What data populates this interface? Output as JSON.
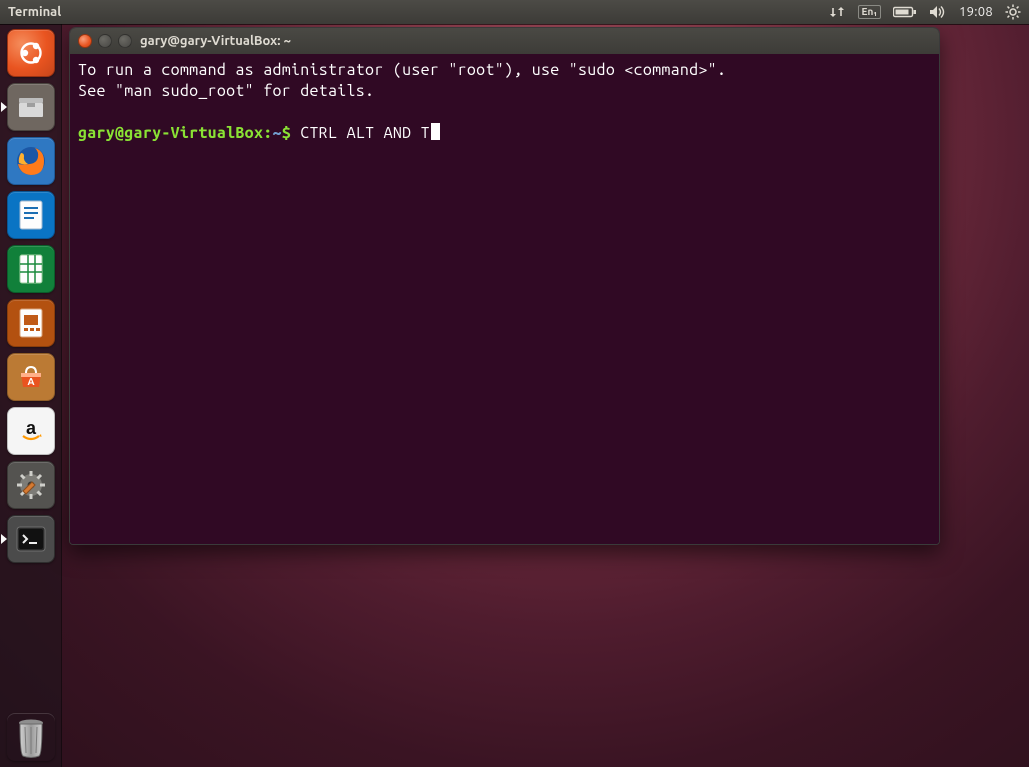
{
  "menubar": {
    "app_title": "Terminal",
    "lang": "En₁",
    "clock": "19:08"
  },
  "launcher": {
    "items": [
      {
        "name": "dash-home-icon"
      },
      {
        "name": "files-icon"
      },
      {
        "name": "firefox-icon"
      },
      {
        "name": "libreoffice-writer-icon"
      },
      {
        "name": "libreoffice-calc-icon"
      },
      {
        "name": "libreoffice-impress-icon"
      },
      {
        "name": "ubuntu-software-icon"
      },
      {
        "name": "amazon-icon"
      },
      {
        "name": "system-settings-icon"
      },
      {
        "name": "terminal-icon"
      },
      {
        "name": "trash-icon"
      }
    ]
  },
  "window": {
    "title": "gary@gary-VirtualBox: ~",
    "motd_line1": "To run a command as administrator (user \"root\"), use \"sudo <command>\".",
    "motd_line2": "See \"man sudo_root\" for details.",
    "prompt_userhost": "gary@gary-VirtualBox:",
    "prompt_tilde": "~",
    "prompt_dollar": "$",
    "prompt_typed": "CTRL ALT AND T"
  }
}
